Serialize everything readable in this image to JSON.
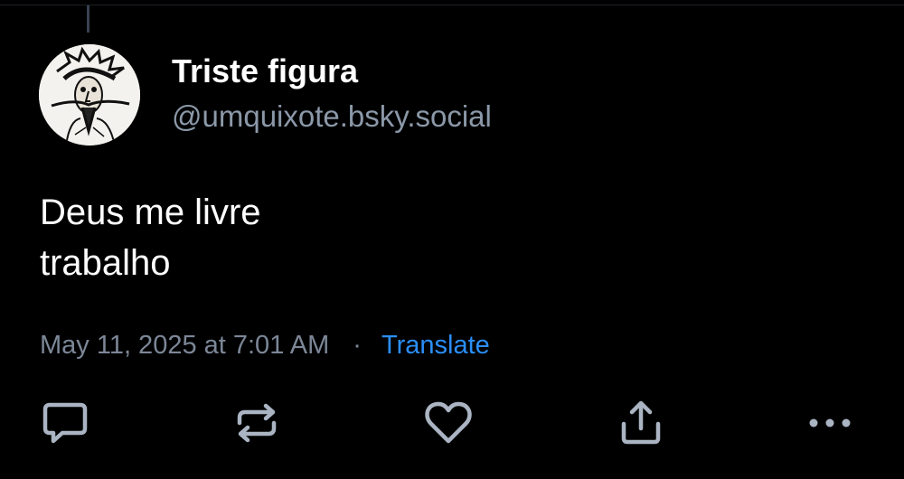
{
  "post": {
    "author": {
      "display_name": "Triste figura",
      "handle": "@umquixote.bsky.social",
      "avatar": "quixote-sketch-avatar"
    },
    "text_lines": [
      "Deus me livre",
      "trabalho"
    ],
    "timestamp": "May 11, 2025 at 7:01 AM",
    "separator": "·",
    "translate_label": "Translate"
  },
  "actions": [
    {
      "name": "reply",
      "icon": "speech-bubble-icon"
    },
    {
      "name": "repost",
      "icon": "repost-arrows-icon"
    },
    {
      "name": "like",
      "icon": "heart-icon"
    },
    {
      "name": "share",
      "icon": "share-upload-icon"
    },
    {
      "name": "more",
      "icon": "ellipsis-icon"
    }
  ],
  "colors": {
    "background": "#000000",
    "primary_text": "#ffffff",
    "secondary_text": "#8b98a8",
    "link": "#2b8ef7",
    "icon": "#aab4c2"
  }
}
